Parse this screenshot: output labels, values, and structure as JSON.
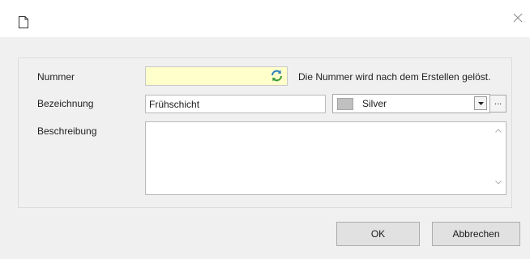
{
  "dialog": {
    "close_icon": "close-icon",
    "doc_icon": "document-icon"
  },
  "form": {
    "nummer": {
      "label": "Nummer",
      "value": "",
      "hint": "Die Nummer wird nach dem Erstellen gelöst.",
      "refresh_icon": "refresh-icon",
      "background": "#ffffcc"
    },
    "bezeichnung": {
      "label": "Bezeichnung",
      "value": "Frühschicht",
      "color_name": "Silver",
      "color_swatch": "#c0c0c0",
      "ellipsis": "..."
    },
    "beschreibung": {
      "label": "Beschreibung",
      "value": ""
    }
  },
  "buttons": {
    "ok": "OK",
    "cancel": "Abbrechen"
  }
}
